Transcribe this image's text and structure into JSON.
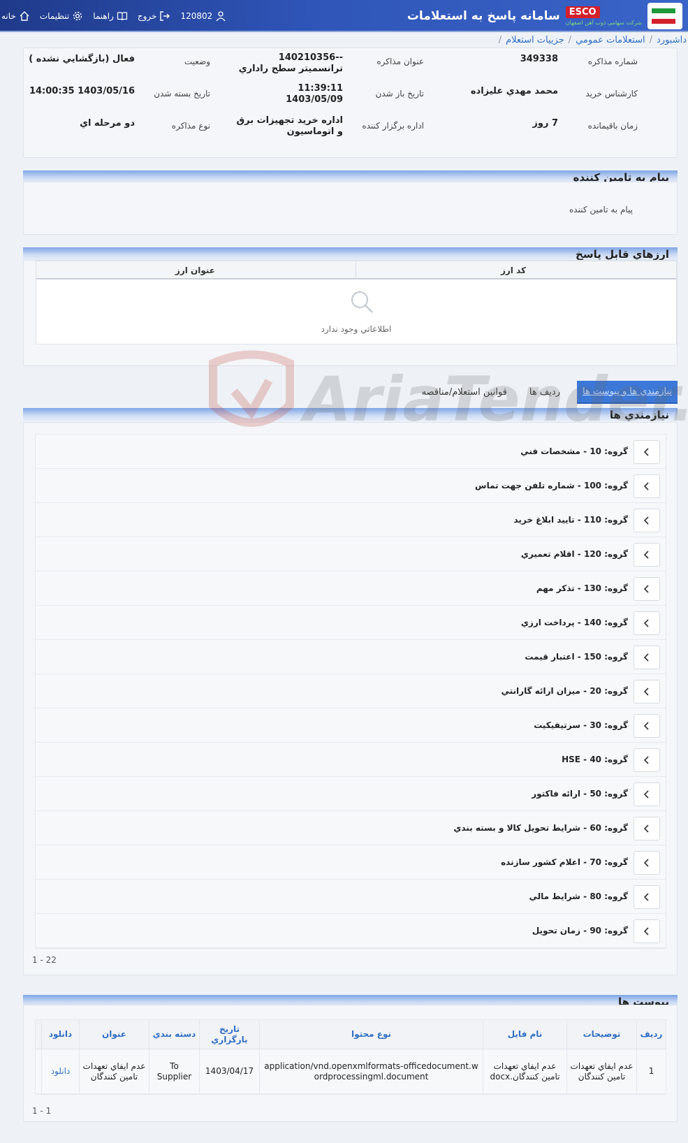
{
  "header": {
    "title": "سامانه پاسخ به استعلامات",
    "brand_badge": "ESCO",
    "brand_subtitle": "شرکت سهامی ذوب آهن اصفهان",
    "nav": {
      "home": "خانه",
      "settings": "تنظیمات",
      "help": "راهنما",
      "logout": "خروج",
      "user_id": "120802"
    }
  },
  "breadcrumb": [
    "داشبورد",
    "استعلامات عمومي",
    "جزييات استعلام"
  ],
  "info": {
    "number_label": "شماره مذاکره",
    "number_value": "349338",
    "title_label": "عنوان مذاکره",
    "title_value_line1": "--140210356",
    "title_value_line2": "ترانسميتر سطح راداري",
    "status_label": "وضعيت",
    "status_value": "فعال (بازگشايي نشده )",
    "expert_label": "کارشناس خريد",
    "expert_value": "محمد مهدي عليزاده",
    "open_label": "تاريخ باز شدن",
    "open_value_line1": "11:39:11",
    "open_value_line2": "1403/05/09",
    "close_label": "تاريخ بسته شدن",
    "close_value": "1403/05/16 14:00:35",
    "remaining_label": "زمان باقيمانده",
    "remaining_value": "7 روز",
    "dept_label": "اداره برگزار کننده",
    "dept_value_line1": "اداره خريد تجهيزات برق",
    "dept_value_line2": "و اتوماسيون",
    "type_label": "نوع مذاکره",
    "type_value": "دو مرحله اي"
  },
  "supplier_message": {
    "title": "پيام به تامين کننده",
    "body": "پيام به تامين کننده"
  },
  "currencies": {
    "title": "ارزهاي قابل پاسخ",
    "columns": [
      "کد ارز",
      "عنوان ارز"
    ],
    "empty_text": "اطلاعاتي وجود ندارد"
  },
  "tabs": [
    "نيازمندي ها و پيوست ها",
    "رديف ها",
    "قوانين استعلام/مناقصه"
  ],
  "requirements": {
    "title": "نيازمندي ها",
    "groups": [
      "گروه: 10 - مشخصات فني",
      "گروه: 100 - شماره تلفن جهت تماس",
      "گروه: 110 - تاييد ابلاغ خريد",
      "گروه: 120 - اقلام تعميري",
      "گروه: 130 - تذکر مهم",
      "گروه: 140 - پرداخت ارزي",
      "گروه: 150 - اعتبار قيمت",
      "گروه: 20 - ميزان ارائه گارانتي",
      "گروه: 30 - سرتيفيکيت",
      "گروه: 40 - HSE",
      "گروه: 50 - ارائه فاکتور",
      "گروه: 60 - شرايط تحويل کالا و بسته بندي",
      "گروه: 70 - اعلام کشور سازنده",
      "گروه: 80 - شرايط مالي",
      "گروه: 90 - زمان تحويل"
    ],
    "pager": "1 - 22"
  },
  "attachments": {
    "title": "پيوست ها",
    "columns": [
      "رديف",
      "توضيحات",
      "نام فايل",
      "نوع محتوا",
      "تاريخ بارگزاري",
      "دسته بندي",
      "عنوان",
      "دانلود"
    ],
    "rows": [
      {
        "index": "1",
        "description": "عدم ايفاي تعهدات تامين کنندگان",
        "file_name": "عدم ايفاي تعهدات تامين کنندگان.docx",
        "content_type": "application/vnd.openxmlformats-officedocument.wordprocessingml.document",
        "upload_date": "1403/04/17",
        "category": "To Supplier",
        "title": "عدم ايفاي تعهدات تامين کنندگان",
        "download": "دانلود"
      }
    ],
    "pager": "1 - 1"
  },
  "watermark": "AriaTender.neT",
  "colors": {
    "header_bg": "#2f55b8",
    "link": "#2f6fc4",
    "brand_red": "#d4202b",
    "active_tab": "#3c78d8"
  }
}
